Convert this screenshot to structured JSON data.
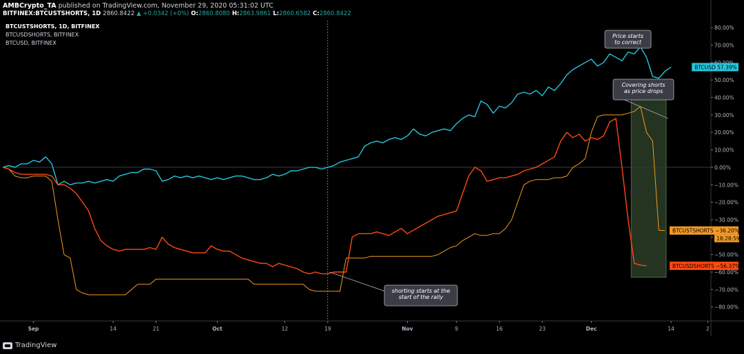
{
  "header": {
    "publisher": "AMBCrypto_TA",
    "published_text": "published on TradingView.com, November 29, 2020 05:31:02 UTC",
    "symbol": "BITFINEX:BTCUSTSHORTS, 1D",
    "last": "2860.8422",
    "change": "▲ +0.0342 (+0%)",
    "o_label": "O:",
    "o": "2860.8080",
    "h_label": "H:",
    "h": "2863.9861",
    "l_label": "L:",
    "l": "2860.6582",
    "c_label": "C:",
    "c": "2860.8422"
  },
  "legend": [
    "BTCUSTSHORTS, 1D, BITFINEX",
    "BTCUSDSHORTS, BITFINEX",
    "BTCUSD, BITFINEX"
  ],
  "footer": {
    "brand": "TradingView"
  },
  "colors": {
    "btcusd": "#26c6da",
    "btcust": "#f59b23",
    "btcusd_shorts": "#ff4a12",
    "box": "#3d5a3a"
  },
  "chart_data": {
    "type": "line",
    "x_unit": "day index from Aug 27, 2020 (daily bars)",
    "x_ticks": [
      {
        "label": "Sep",
        "day": 5
      },
      {
        "label": "14",
        "day": 18
      },
      {
        "label": "21",
        "day": 25
      },
      {
        "label": "Oct",
        "day": 35
      },
      {
        "label": "12",
        "day": 46
      },
      {
        "label": "19",
        "day": 53
      },
      {
        "label": "Nov",
        "day": 66
      },
      {
        "label": "9",
        "day": 74
      },
      {
        "label": "16",
        "day": 81
      },
      {
        "label": "23",
        "day": 88
      },
      {
        "label": "Dec",
        "day": 96
      },
      {
        "label": "14",
        "day": 109
      },
      {
        "label": "2",
        "day": 115
      }
    ],
    "xlim": [
      0,
      115.5
    ],
    "ylim": [
      -88,
      84
    ],
    "y_ticks": [
      80,
      70,
      60,
      50,
      40,
      30,
      20,
      10,
      0,
      -10,
      -20,
      -30,
      -40,
      -50,
      -60,
      -70,
      -80
    ],
    "y_tick_labels": [
      "80.00%",
      "70.00%",
      "60.00%",
      "50.00%",
      "40.00%",
      "30.00%",
      "20.00%",
      "10.00%",
      "0.00%",
      "−10.00%",
      "−20.00%",
      "−30.00%",
      "−40.00%",
      "−50.00%",
      "−60.00%",
      "−70.00%",
      "−80.00%"
    ],
    "series": [
      {
        "name": "BTCUSD",
        "color": "#26c6da",
        "label": "BTCUSD",
        "value_label": "57.39%",
        "values": [
          0,
          1,
          0,
          2,
          2,
          4,
          3,
          6,
          2,
          -10,
          -8,
          -10,
          -9,
          -9,
          -8,
          -9,
          -8,
          -7,
          -8,
          -5,
          -4,
          -3,
          -3,
          -1,
          -1,
          -2,
          -8,
          -7,
          -5,
          -6,
          -5,
          -6,
          -5,
          -6,
          -7,
          -6,
          -7,
          -6,
          -5,
          -5,
          -6,
          -7,
          -7,
          -6,
          -4,
          -5,
          -4,
          -2,
          -2,
          -1,
          0,
          0,
          -1,
          0,
          1,
          3,
          4,
          5,
          6,
          12,
          14,
          15,
          14,
          16,
          17,
          16,
          18,
          22,
          19,
          18,
          20,
          21,
          22,
          21,
          25,
          28,
          30,
          29,
          38,
          36,
          31,
          35,
          34,
          37,
          42,
          43,
          42,
          44,
          41,
          46,
          44,
          48,
          53,
          56,
          58,
          60,
          62,
          58,
          60,
          65,
          63,
          61,
          66,
          65,
          69,
          63,
          52,
          51,
          55,
          57.4
        ]
      },
      {
        "name": "BTCUSTSHORTS",
        "color": "#f59b23",
        "label": "BTCUSTSHORTS",
        "value_label": "−36.20%",
        "time_label": "18:28:59",
        "values": [
          0,
          -1,
          -5,
          -6,
          -6,
          -5,
          -5,
          -5,
          -8,
          -30,
          -50,
          -52,
          -70,
          -72,
          -73,
          -73,
          -73,
          -73,
          -73,
          -73,
          -73,
          -70,
          -67,
          -67,
          -67,
          -64,
          -64,
          -64,
          -64,
          -64,
          -64,
          -64,
          -64,
          -64,
          -64,
          -64,
          -64,
          -64,
          -64,
          -64,
          -64,
          -67,
          -67,
          -67,
          -67,
          -67,
          -67,
          -67,
          -67,
          -67,
          -70,
          -71,
          -71,
          -71,
          -71,
          -71,
          -52,
          -52,
          -52,
          -52,
          -51,
          -51,
          -51,
          -51,
          -51,
          -51,
          -51,
          -51,
          -51,
          -51,
          -51,
          -50,
          -48,
          -46,
          -45,
          -42,
          -40,
          -38,
          -39,
          -39,
          -38,
          -38,
          -35,
          -30,
          -20,
          -10,
          -8,
          -7,
          -7,
          -7,
          -6,
          -6,
          -5,
          0,
          2,
          5,
          20,
          29,
          30,
          30,
          30,
          30,
          31,
          32,
          35,
          20,
          15,
          -36,
          -36.2
        ]
      },
      {
        "name": "BTCUSDSHORTS",
        "color": "#ff4a12",
        "label": "BTCUSDSHORTS",
        "value_label": "−56.37%",
        "values": [
          0,
          -1,
          -3,
          -4,
          -4,
          -4,
          -4,
          -4,
          -5,
          -10,
          -10,
          -12,
          -15,
          -20,
          -25,
          -35,
          -42,
          -45,
          -47,
          -48,
          -47,
          -47,
          -47,
          -47,
          -46,
          -47,
          -40,
          -44,
          -46,
          -47,
          -48,
          -49,
          -49,
          -49,
          -45,
          -47,
          -48,
          -48,
          -50,
          -52,
          -53,
          -54,
          -55,
          -55,
          -57,
          -55,
          -56,
          -57,
          -58,
          -60,
          -61,
          -60,
          -61,
          -61,
          -60,
          -60,
          -60,
          -40,
          -38,
          -38,
          -38,
          -37,
          -38,
          -39,
          -37,
          -35,
          -38,
          -36,
          -34,
          -32,
          -30,
          -28,
          -27,
          -26,
          -25,
          -15,
          -5,
          0,
          -2,
          -8,
          -7,
          -6,
          -6,
          -5,
          -4,
          -2,
          -1,
          0,
          2,
          4,
          6,
          15,
          20,
          17,
          19,
          15,
          17,
          16,
          18,
          26,
          28,
          0,
          -30,
          -55,
          -56,
          -56.4
        ]
      }
    ],
    "annotations": [
      {
        "text": "Price starts to correct",
        "lines": [
          "Price starts",
          "to correct"
        ]
      },
      {
        "text": "Covering shorts as price drops",
        "lines": [
          "Covering shorts",
          "as price drops"
        ]
      },
      {
        "text": "shorting starts at the start of the rally",
        "lines": [
          "shorting starts at the",
          "start of the rally"
        ]
      }
    ],
    "grid": false,
    "vertical_marker_day": 53
  }
}
